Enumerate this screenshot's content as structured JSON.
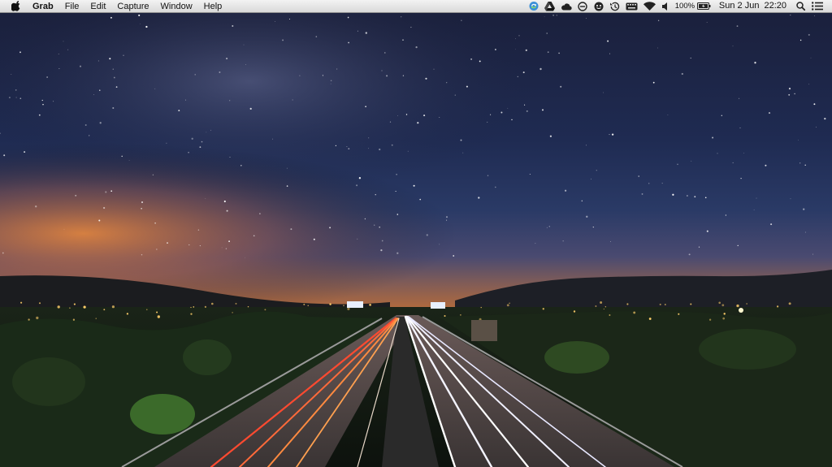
{
  "menubar": {
    "app_name": "Grab",
    "menus": [
      "File",
      "Edit",
      "Capture",
      "Window",
      "Help"
    ],
    "status": {
      "battery_percent": "100%",
      "date": "Sun 2 Jun",
      "time": "22:20"
    },
    "icons": [
      "apple-icon",
      "sync-icon",
      "google-drive-icon",
      "cloud-icon",
      "do-not-disturb-icon",
      "face-icon",
      "time-machine-icon",
      "keyboard-icon",
      "wifi-icon",
      "volume-icon",
      "battery-icon",
      "spotlight-icon",
      "notification-center-icon"
    ]
  },
  "desktop": {
    "wallpaper": "night highway with star trails and milky way",
    "colors": {
      "sky_top": "#1a2140",
      "horizon_glow": "#e08a3a",
      "road_light_red": "#ff5a3a",
      "road_light_white": "#f4f4ff"
    }
  }
}
